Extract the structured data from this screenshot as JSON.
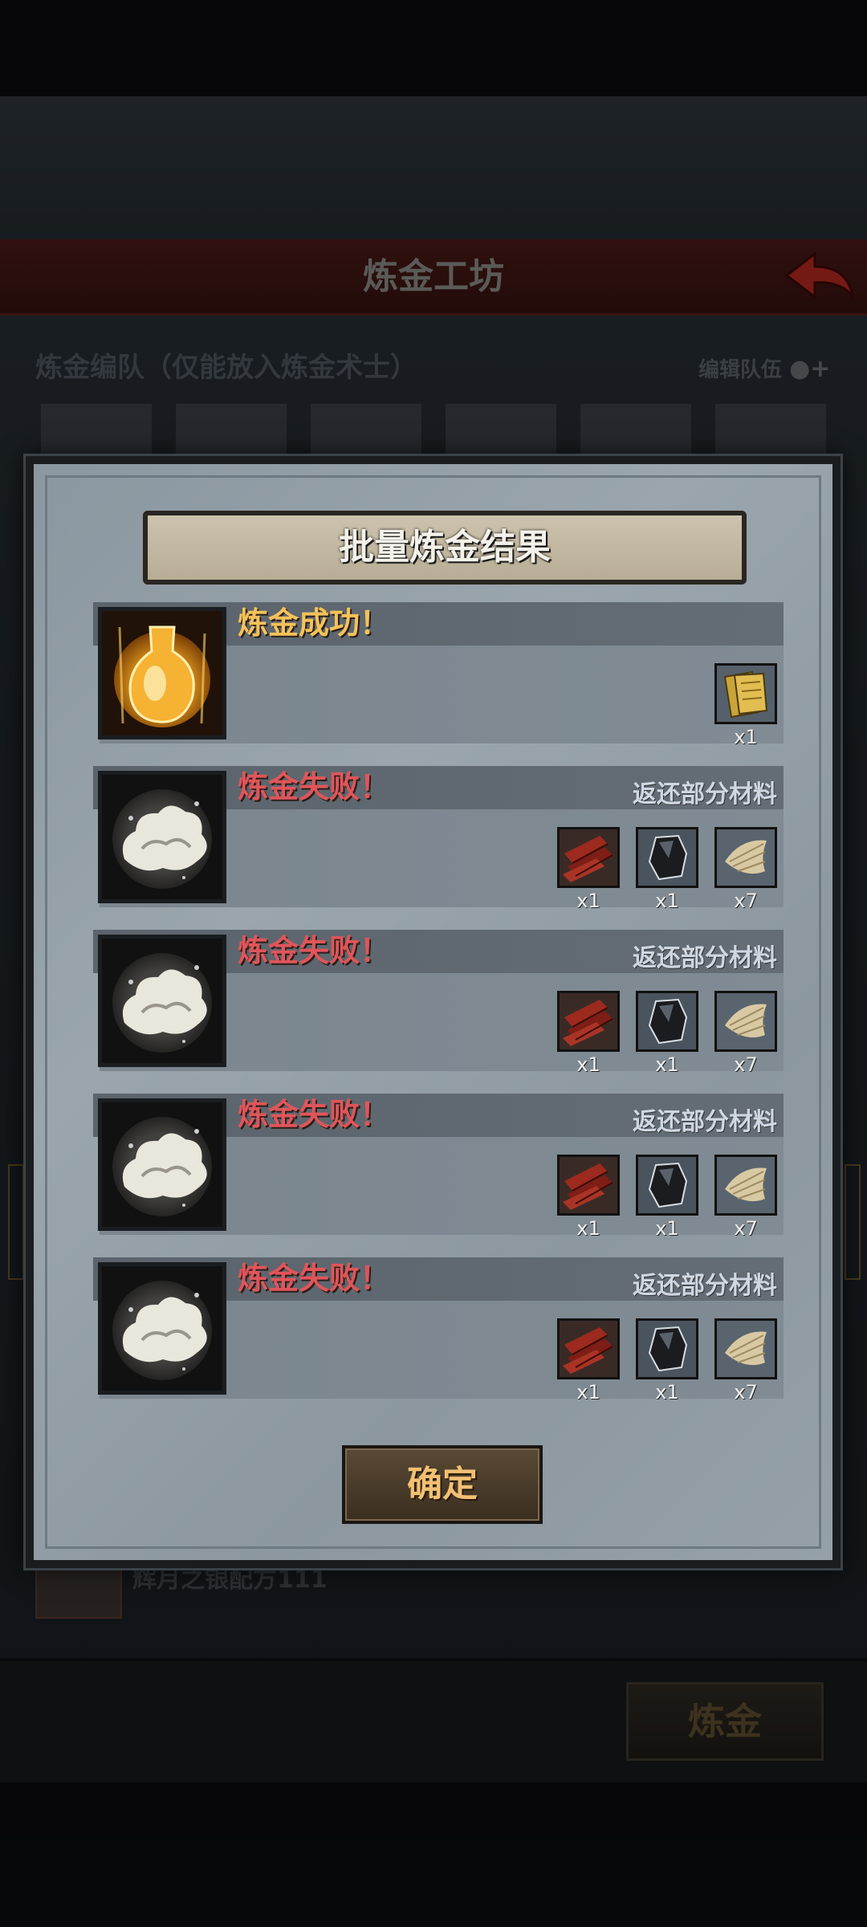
{
  "background": {
    "screen_title": "炼金工坊",
    "team_label": "炼金编队（仅能放入炼金术士）",
    "edit_team": "编辑队伍",
    "recipe_name": "辉月之银配方111",
    "alchemy_button": "炼金"
  },
  "dialog": {
    "title": "批量炼金结果",
    "confirm": "确定",
    "results": [
      {
        "status": "炼金成功！",
        "kind": "success",
        "return_label": "",
        "materials": [
          {
            "icon": "golden-scroll-icon",
            "qty": "x1"
          }
        ]
      },
      {
        "status": "炼金失败！",
        "kind": "fail",
        "return_label": "返还部分材料",
        "materials": [
          {
            "icon": "wood-planks-icon",
            "qty": "x1"
          },
          {
            "icon": "dark-ore-icon",
            "qty": "x1"
          },
          {
            "icon": "fiber-bundle-icon",
            "qty": "x7"
          }
        ]
      },
      {
        "status": "炼金失败！",
        "kind": "fail",
        "return_label": "返还部分材料",
        "materials": [
          {
            "icon": "wood-planks-icon",
            "qty": "x1"
          },
          {
            "icon": "dark-ore-icon",
            "qty": "x1"
          },
          {
            "icon": "fiber-bundle-icon",
            "qty": "x7"
          }
        ]
      },
      {
        "status": "炼金失败！",
        "kind": "fail",
        "return_label": "返还部分材料",
        "materials": [
          {
            "icon": "wood-planks-icon",
            "qty": "x1"
          },
          {
            "icon": "dark-ore-icon",
            "qty": "x1"
          },
          {
            "icon": "fiber-bundle-icon",
            "qty": "x7"
          }
        ]
      },
      {
        "status": "炼金失败！",
        "kind": "fail",
        "return_label": "返还部分材料",
        "materials": [
          {
            "icon": "wood-planks-icon",
            "qty": "x1"
          },
          {
            "icon": "dark-ore-icon",
            "qty": "x1"
          },
          {
            "icon": "fiber-bundle-icon",
            "qty": "x7"
          }
        ]
      }
    ]
  },
  "colors": {
    "success": "#f5c25a",
    "fail": "#e0555a",
    "return_text": "#cfd8e2"
  }
}
